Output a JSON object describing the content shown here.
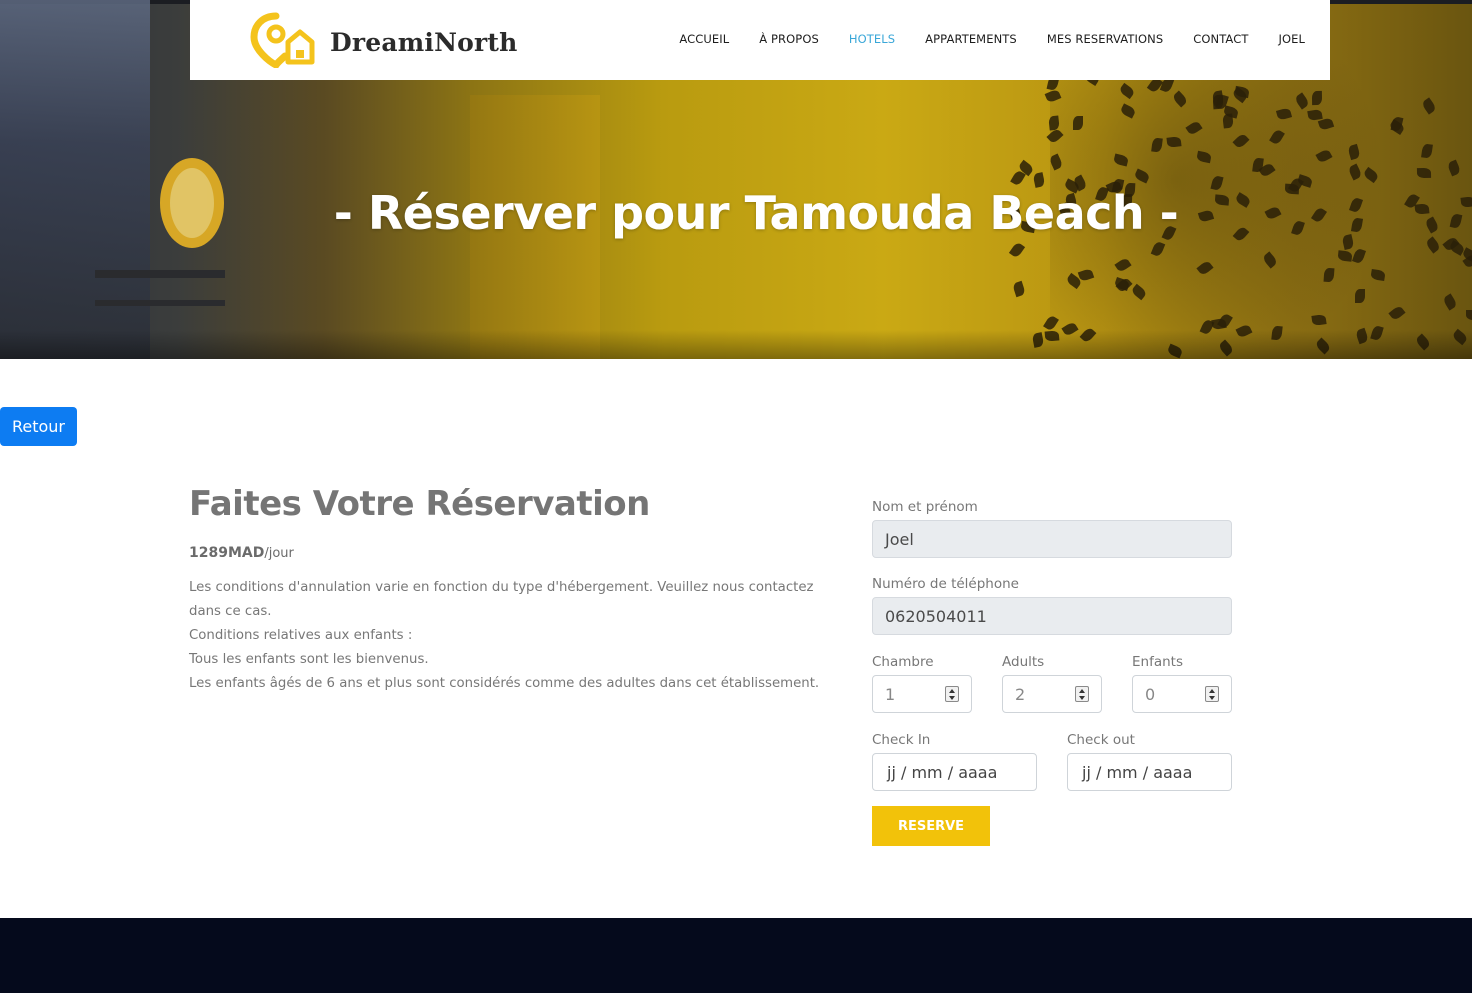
{
  "header": {
    "brand": "DreamiNorth",
    "nav": [
      {
        "label": "ACCUEIL",
        "active": false
      },
      {
        "label": "À PROPOS",
        "active": false
      },
      {
        "label": "HOTELS",
        "active": true
      },
      {
        "label": "APPARTEMENTS",
        "active": false
      },
      {
        "label": "MES RESERVATIONS",
        "active": false
      },
      {
        "label": "CONTACT",
        "active": false
      },
      {
        "label": "JOEL",
        "active": false
      }
    ]
  },
  "hero": {
    "title": "- Réserver pour Tamouda Beach -"
  },
  "back_button": {
    "label": "Retour"
  },
  "reservation": {
    "heading": "Faites Votre Réservation",
    "price_amount": "1289MAD",
    "price_unit": "/jour",
    "description": [
      "Les conditions d'annulation varie en fonction du type d'hébergement. Veuillez nous contactez dans ce cas.",
      "Conditions relatives aux enfants :",
      "Tous les enfants sont les bienvenus.",
      "Les enfants âgés de 6 ans et plus sont considérés comme des adultes dans cet établissement."
    ]
  },
  "form": {
    "name_label": "Nom et prénom",
    "name_value": "Joel",
    "phone_label": "Numéro de téléphone",
    "phone_value": "0620504011",
    "room_label": "Chambre",
    "room_value": "1",
    "adults_label": "Adults",
    "adults_value": "2",
    "children_label": "Enfants",
    "children_value": "0",
    "checkin_label": "Check In",
    "checkin_placeholder": "jj / mm / aaaa",
    "checkout_label": "Check out",
    "checkout_placeholder": "jj / mm / aaaa",
    "submit_label": "RESERVE"
  },
  "colors": {
    "accent": "#f2c20a",
    "primary_button": "#0d7cf2",
    "nav_active": "#3aa7d8",
    "footer": "#050a1c"
  },
  "icons": {
    "logo": "location-pin-house-icon",
    "spinner": "number-spinner-icon"
  }
}
